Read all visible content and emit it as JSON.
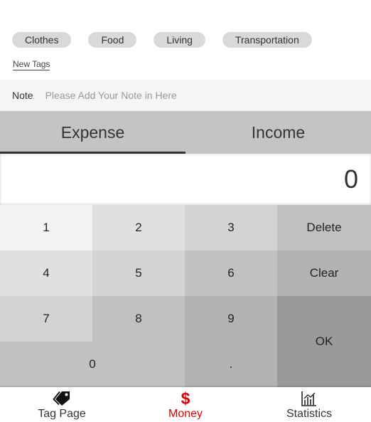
{
  "tags": {
    "items": [
      "Clothes",
      "Food",
      "Living",
      "Transportation"
    ],
    "new_tags_label": "New Tags"
  },
  "note": {
    "label": "Note",
    "placeholder": "Please Add Your Note in Here",
    "value": ""
  },
  "type_tabs": {
    "expense_label": "Expense",
    "income_label": "Income",
    "selected": "Expense"
  },
  "amount": {
    "value": "0"
  },
  "keypad": {
    "key_1": "1",
    "key_2": "2",
    "key_3": "3",
    "key_4": "4",
    "key_5": "5",
    "key_6": "6",
    "key_7": "7",
    "key_8": "8",
    "key_9": "9",
    "key_0": "0",
    "key_dot": ".",
    "delete_label": "Delete",
    "clear_label": "Clear",
    "ok_label": "OK"
  },
  "bottom_nav": {
    "tag_page_label": "Tag Page",
    "money_label": "Money",
    "statistics_label": "Statistics",
    "money_icon_glyph": "$",
    "active": "Money",
    "active_color": "#e00000",
    "icons": {
      "tag_page": "tag-icon",
      "money": "dollar-icon",
      "statistics": "chart-icon"
    }
  }
}
